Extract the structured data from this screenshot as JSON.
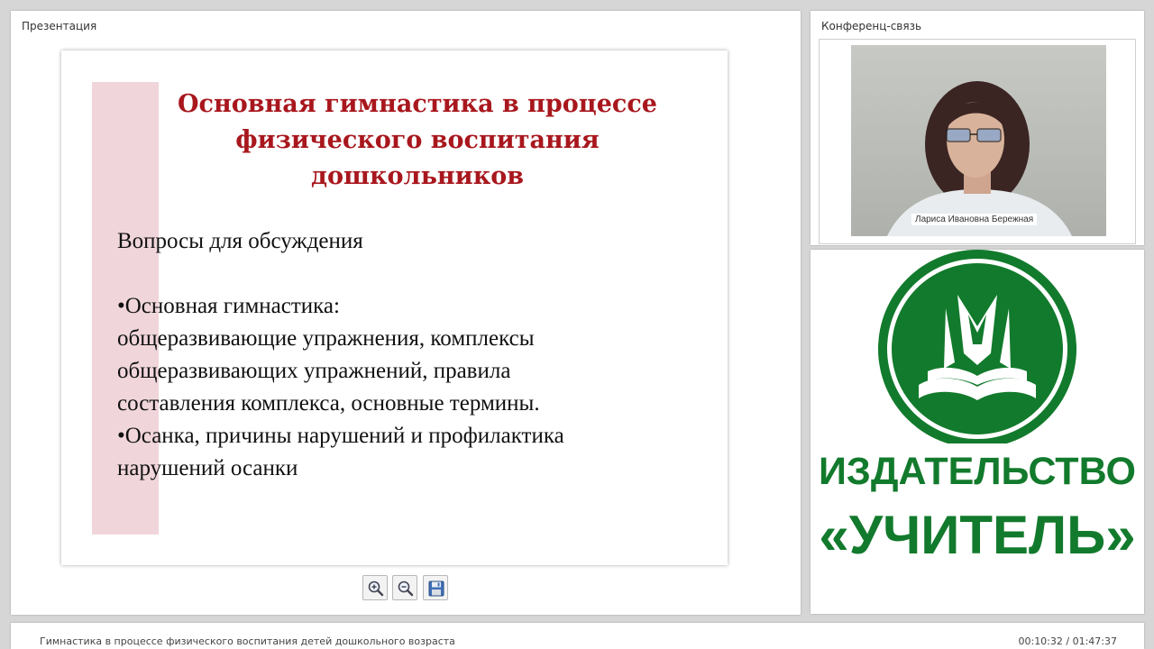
{
  "presentation_panel": {
    "title": "Презентация",
    "slide": {
      "title": "Основная гимнастика  в процессе\nфизического воспитания\nдошкольников",
      "subtitle": "Вопросы для обсуждения",
      "bullets": [
        "•Основная гимнастика:\nобщеразвивающие упражнения, комплексы\nобщеразвивающих упражнений, правила\nсоставления комплекса,  основные термины.",
        "•Осанка, причины нарушений и профилактика\nнарушений осанки"
      ]
    },
    "toolbar": {
      "zoom_in_icon": "zoom-in-icon",
      "zoom_out_icon": "zoom-out-icon",
      "save_icon": "floppy-disk-icon"
    }
  },
  "conference_panel": {
    "title": "Конференц-связь",
    "participant_name": "Лариса Ивановна Бережная"
  },
  "publisher_panel": {
    "line1": "ИЗДАТЕЛЬСТВО",
    "line2": "«УЧИТЕЛЬ»",
    "brand_color": "#127a2c"
  },
  "footer": {
    "title": "Гимнастика в процессе физического воспитания детей дошкольного возраста",
    "time": "00:10:32 / 01:47:37"
  }
}
